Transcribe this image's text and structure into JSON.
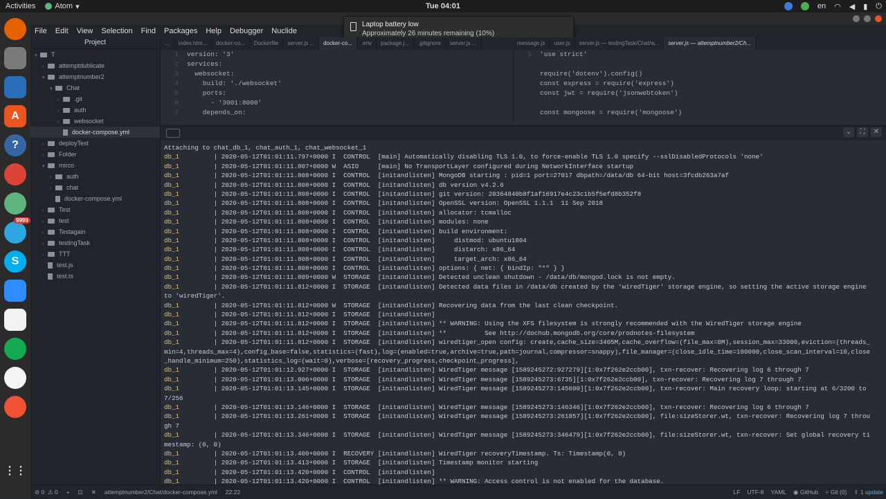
{
  "topbar": {
    "activities": "Activities",
    "app_name": "Atom",
    "clock": "Tue 04:01",
    "lang": "en"
  },
  "notification": {
    "title": "Laptop battery low",
    "message": "Approximately 26 minutes remaining (10%)"
  },
  "dock": {
    "telegram_badge": "9999"
  },
  "menu": [
    "File",
    "Edit",
    "View",
    "Selection",
    "Find",
    "Packages",
    "Help",
    "Debugger",
    "Nuclide"
  ],
  "project": {
    "title": "Project",
    "tree": [
      {
        "label": "T",
        "depth": 0,
        "type": "folder",
        "open": true
      },
      {
        "label": "attemptdublicate",
        "depth": 1,
        "type": "folder"
      },
      {
        "label": "attemptnumber2",
        "depth": 1,
        "type": "folder",
        "open": true
      },
      {
        "label": "Chat",
        "depth": 2,
        "type": "folder",
        "open": true
      },
      {
        "label": ".git",
        "depth": 3,
        "type": "folder"
      },
      {
        "label": "auth",
        "depth": 3,
        "type": "folder"
      },
      {
        "label": "websocket",
        "depth": 3,
        "type": "folder"
      },
      {
        "label": "docker-compose.yml",
        "depth": 3,
        "type": "file",
        "selected": true
      },
      {
        "label": "deployTest",
        "depth": 1,
        "type": "folder"
      },
      {
        "label": "Folder",
        "depth": 1,
        "type": "folder"
      },
      {
        "label": "mirco",
        "depth": 1,
        "type": "folder",
        "open": true
      },
      {
        "label": "auth",
        "depth": 2,
        "type": "folder"
      },
      {
        "label": "chat",
        "depth": 2,
        "type": "folder"
      },
      {
        "label": "docker-compose.yml",
        "depth": 2,
        "type": "file"
      },
      {
        "label": "Test",
        "depth": 1,
        "type": "folder"
      },
      {
        "label": "test",
        "depth": 1,
        "type": "folder"
      },
      {
        "label": "Testagain",
        "depth": 1,
        "type": "folder"
      },
      {
        "label": "testingTask",
        "depth": 1,
        "type": "folder"
      },
      {
        "label": "TTT",
        "depth": 1,
        "type": "folder"
      },
      {
        "label": "test.js",
        "depth": 1,
        "type": "file"
      },
      {
        "label": "test.ts",
        "depth": 1,
        "type": "file"
      }
    ]
  },
  "tabs_left": [
    "...",
    "index.htm...",
    "docker-co...",
    "Dockerfile",
    "server.js ...",
    "docker-co...",
    ".env",
    "package.j...",
    ".gitignore",
    "server.js ..."
  ],
  "tabs_right": [
    "message.js",
    "user.js",
    "server.js — testingTask/Chat/w...",
    "server.js — attemptnumber2/Ch..."
  ],
  "editor_left": [
    {
      "n": "1",
      "code": "version: '3'"
    },
    {
      "n": "2",
      "code": "services:"
    },
    {
      "n": "3",
      "code": "  websocket:"
    },
    {
      "n": "4",
      "code": "    build: './websocket'"
    },
    {
      "n": "5",
      "code": "    ports:"
    },
    {
      "n": "6",
      "code": "      - '3001:8000'"
    },
    {
      "n": "7",
      "code": "    depends_on:"
    }
  ],
  "editor_right": [
    {
      "n": "1",
      "code": "'use strict'"
    },
    {
      "n": "",
      "code": ""
    },
    {
      "n": "",
      "code": "require('dotenv').config()"
    },
    {
      "n": "",
      "code": "const express = require('express')"
    },
    {
      "n": "",
      "code": "const jwt = require('jsonwebtoken')"
    },
    {
      "n": "",
      "code": ""
    },
    {
      "n": "",
      "code": "const mongoose = require('mongoose')"
    }
  ],
  "terminal_lines": [
    {
      "p": "",
      "t": "Attaching to chat_db_1, chat_auth_1, chat_websocket_1"
    },
    {
      "p": "db_1",
      "t": "         | 2020-05-12T01:01:11.797+0000 I  CONTROL  [main] Automatically disabling TLS 1.0, to force-enable TLS 1.0 specify --sslDisabledProtocols 'none'"
    },
    {
      "p": "db_1",
      "t": "         | 2020-05-12T01:01:11.807+0000 W  ASIO     [main] No TransportLayer configured during NetworkInterface startup"
    },
    {
      "p": "db_1",
      "t": "         | 2020-05-12T01:01:11.808+0000 I  CONTROL  [initandlisten] MongoDB starting : pid=1 port=27017 dbpath=/data/db 64-bit host=3fcdb263a7af"
    },
    {
      "p": "db_1",
      "t": "         | 2020-05-12T01:01:11.808+0000 I  CONTROL  [initandlisten] db version v4.2.6"
    },
    {
      "p": "db_1",
      "t": "         | 2020-05-12T01:01:11.808+0000 I  CONTROL  [initandlisten] git version: 20364840b8f1af16917e4c23c1b5f5efd8b352f8"
    },
    {
      "p": "db_1",
      "t": "         | 2020-05-12T01:01:11.808+0000 I  CONTROL  [initandlisten] OpenSSL version: OpenSSL 1.1.1  11 Sep 2018"
    },
    {
      "p": "db_1",
      "t": "         | 2020-05-12T01:01:11.808+0000 I  CONTROL  [initandlisten] allocator: tcmalloc"
    },
    {
      "p": "db_1",
      "t": "         | 2020-05-12T01:01:11.808+0000 I  CONTROL  [initandlisten] modules: none"
    },
    {
      "p": "db_1",
      "t": "         | 2020-05-12T01:01:11.808+0000 I  CONTROL  [initandlisten] build environment:"
    },
    {
      "p": "db_1",
      "t": "         | 2020-05-12T01:01:11.808+0000 I  CONTROL  [initandlisten]     distmod: ubuntu1804"
    },
    {
      "p": "db_1",
      "t": "         | 2020-05-12T01:01:11.808+0000 I  CONTROL  [initandlisten]     distarch: x86_64"
    },
    {
      "p": "db_1",
      "t": "         | 2020-05-12T01:01:11.808+0000 I  CONTROL  [initandlisten]     target_arch: x86_64"
    },
    {
      "p": "db_1",
      "t": "         | 2020-05-12T01:01:11.808+0000 I  CONTROL  [initandlisten] options: { net: { bindIp: \"*\" } }"
    },
    {
      "p": "db_1",
      "t": "         | 2020-05-12T01:01:11.809+0000 W  STORAGE  [initandlisten] Detected unclean shutdown - /data/db/mongod.lock is not empty."
    },
    {
      "p": "db_1",
      "t": "         | 2020-05-12T01:01:11.812+0000 I  STORAGE  [initandlisten] Detected data files in /data/db created by the 'wiredTiger' storage engine, so setting the active storage engine"
    },
    {
      "p": "",
      "t": "to 'wiredTiger'."
    },
    {
      "p": "db_1",
      "t": "         | 2020-05-12T01:01:11.812+0000 W  STORAGE  [initandlisten] Recovering data from the last clean checkpoint."
    },
    {
      "p": "db_1",
      "t": "         | 2020-05-12T01:01:11.812+0000 I  STORAGE  [initandlisten]"
    },
    {
      "p": "db_1",
      "t": "         | 2020-05-12T01:01:11.812+0000 I  STORAGE  [initandlisten] ** WARNING: Using the XFS filesystem is strongly recommended with the WiredTiger storage engine"
    },
    {
      "p": "db_1",
      "t": "         | 2020-05-12T01:01:11.812+0000 I  STORAGE  [initandlisten] **          See http://dochub.mongodb.org/core/prodnotes-filesystem"
    },
    {
      "p": "db_1",
      "t": "         | 2020-05-12T01:01:11.812+0000 I  STORAGE  [initandlisten] wiredtiger_open config: create,cache_size=3405M,cache_overflow=(file_max=0M),session_max=33000,eviction=(threads_"
    },
    {
      "p": "",
      "t": "min=4,threads_max=4),config_base=false,statistics=(fast),log=(enabled=true,archive=true,path=journal,compressor=snappy),file_manager=(close_idle_time=100000,close_scan_interval=10,close"
    },
    {
      "p": "",
      "t": "_handle_minimum=250),statistics_log=(wait=0),verbose=[recovery_progress,checkpoint_progress],"
    },
    {
      "p": "db_1",
      "t": "         | 2020-05-12T01:01:12.927+0000 I  STORAGE  [initandlisten] WiredTiger message [1589245272:927279][1:0x7f262e2ccb00], txn-recover: Recovering log 6 through 7"
    },
    {
      "p": "db_1",
      "t": "         | 2020-05-12T01:01:13.006+0000 I  STORAGE  [initandlisten] WiredTiger message [1589245273:6735][1:0x7f262e2ccb00], txn-recover: Recovering log 7 through 7"
    },
    {
      "p": "db_1",
      "t": "         | 2020-05-12T01:01:13.145+0000 I  STORAGE  [initandlisten] WiredTiger message [1589245273:145600][1:0x7f262e2ccb00], txn-recover: Main recovery loop: starting at 6/3200 to"
    },
    {
      "p": "",
      "t": "7/256"
    },
    {
      "p": "db_1",
      "t": "         | 2020-05-12T01:01:13.146+0000 I  STORAGE  [initandlisten] WiredTiger message [1589245273:146346][1:0x7f262e2ccb00], txn-recover: Recovering log 6 through 7"
    },
    {
      "p": "db_1",
      "t": "         | 2020-05-12T01:01:13.261+0000 I  STORAGE  [initandlisten] WiredTiger message [1589245273:261857][1:0x7f262e2ccb00], file:sizeStorer.wt, txn-recover: Recovering log 7 throu"
    },
    {
      "p": "",
      "t": "gh 7"
    },
    {
      "p": "db_1",
      "t": "         | 2020-05-12T01:01:13.346+0000 I  STORAGE  [initandlisten] WiredTiger message [1589245273:346479][1:0x7f262e2ccb00], file:sizeStorer.wt, txn-recover: Set global recovery ti"
    },
    {
      "p": "",
      "t": "mestamp: (0, 0)"
    },
    {
      "p": "db_1",
      "t": "         | 2020-05-12T01:01:13.400+0000 I  RECOVERY [initandlisten] WiredTiger recoveryTimestamp. Ts: Timestamp(0, 0)"
    },
    {
      "p": "db_1",
      "t": "         | 2020-05-12T01:01:13.413+0000 I  STORAGE  [initandlisten] Timestamp monitor starting"
    },
    {
      "p": "db_1",
      "t": "         | 2020-05-12T01:01:13.420+0000 I  CONTROL  [initandlisten]"
    },
    {
      "p": "db_1",
      "t": "         | 2020-05-12T01:01:13.420+0000 I  CONTROL  [initandlisten] ** WARNING: Access control is not enabled for the database."
    }
  ],
  "statusbar": {
    "errors": "0",
    "warnings": "0",
    "path": "attemptnumber2/Chat/docker-compose.yml",
    "cursor": "22:22",
    "eol": "LF",
    "encoding": "UTF-8",
    "grammar": "YAML",
    "github": "GitHub",
    "git": "Git (0)",
    "update": "1 update"
  }
}
